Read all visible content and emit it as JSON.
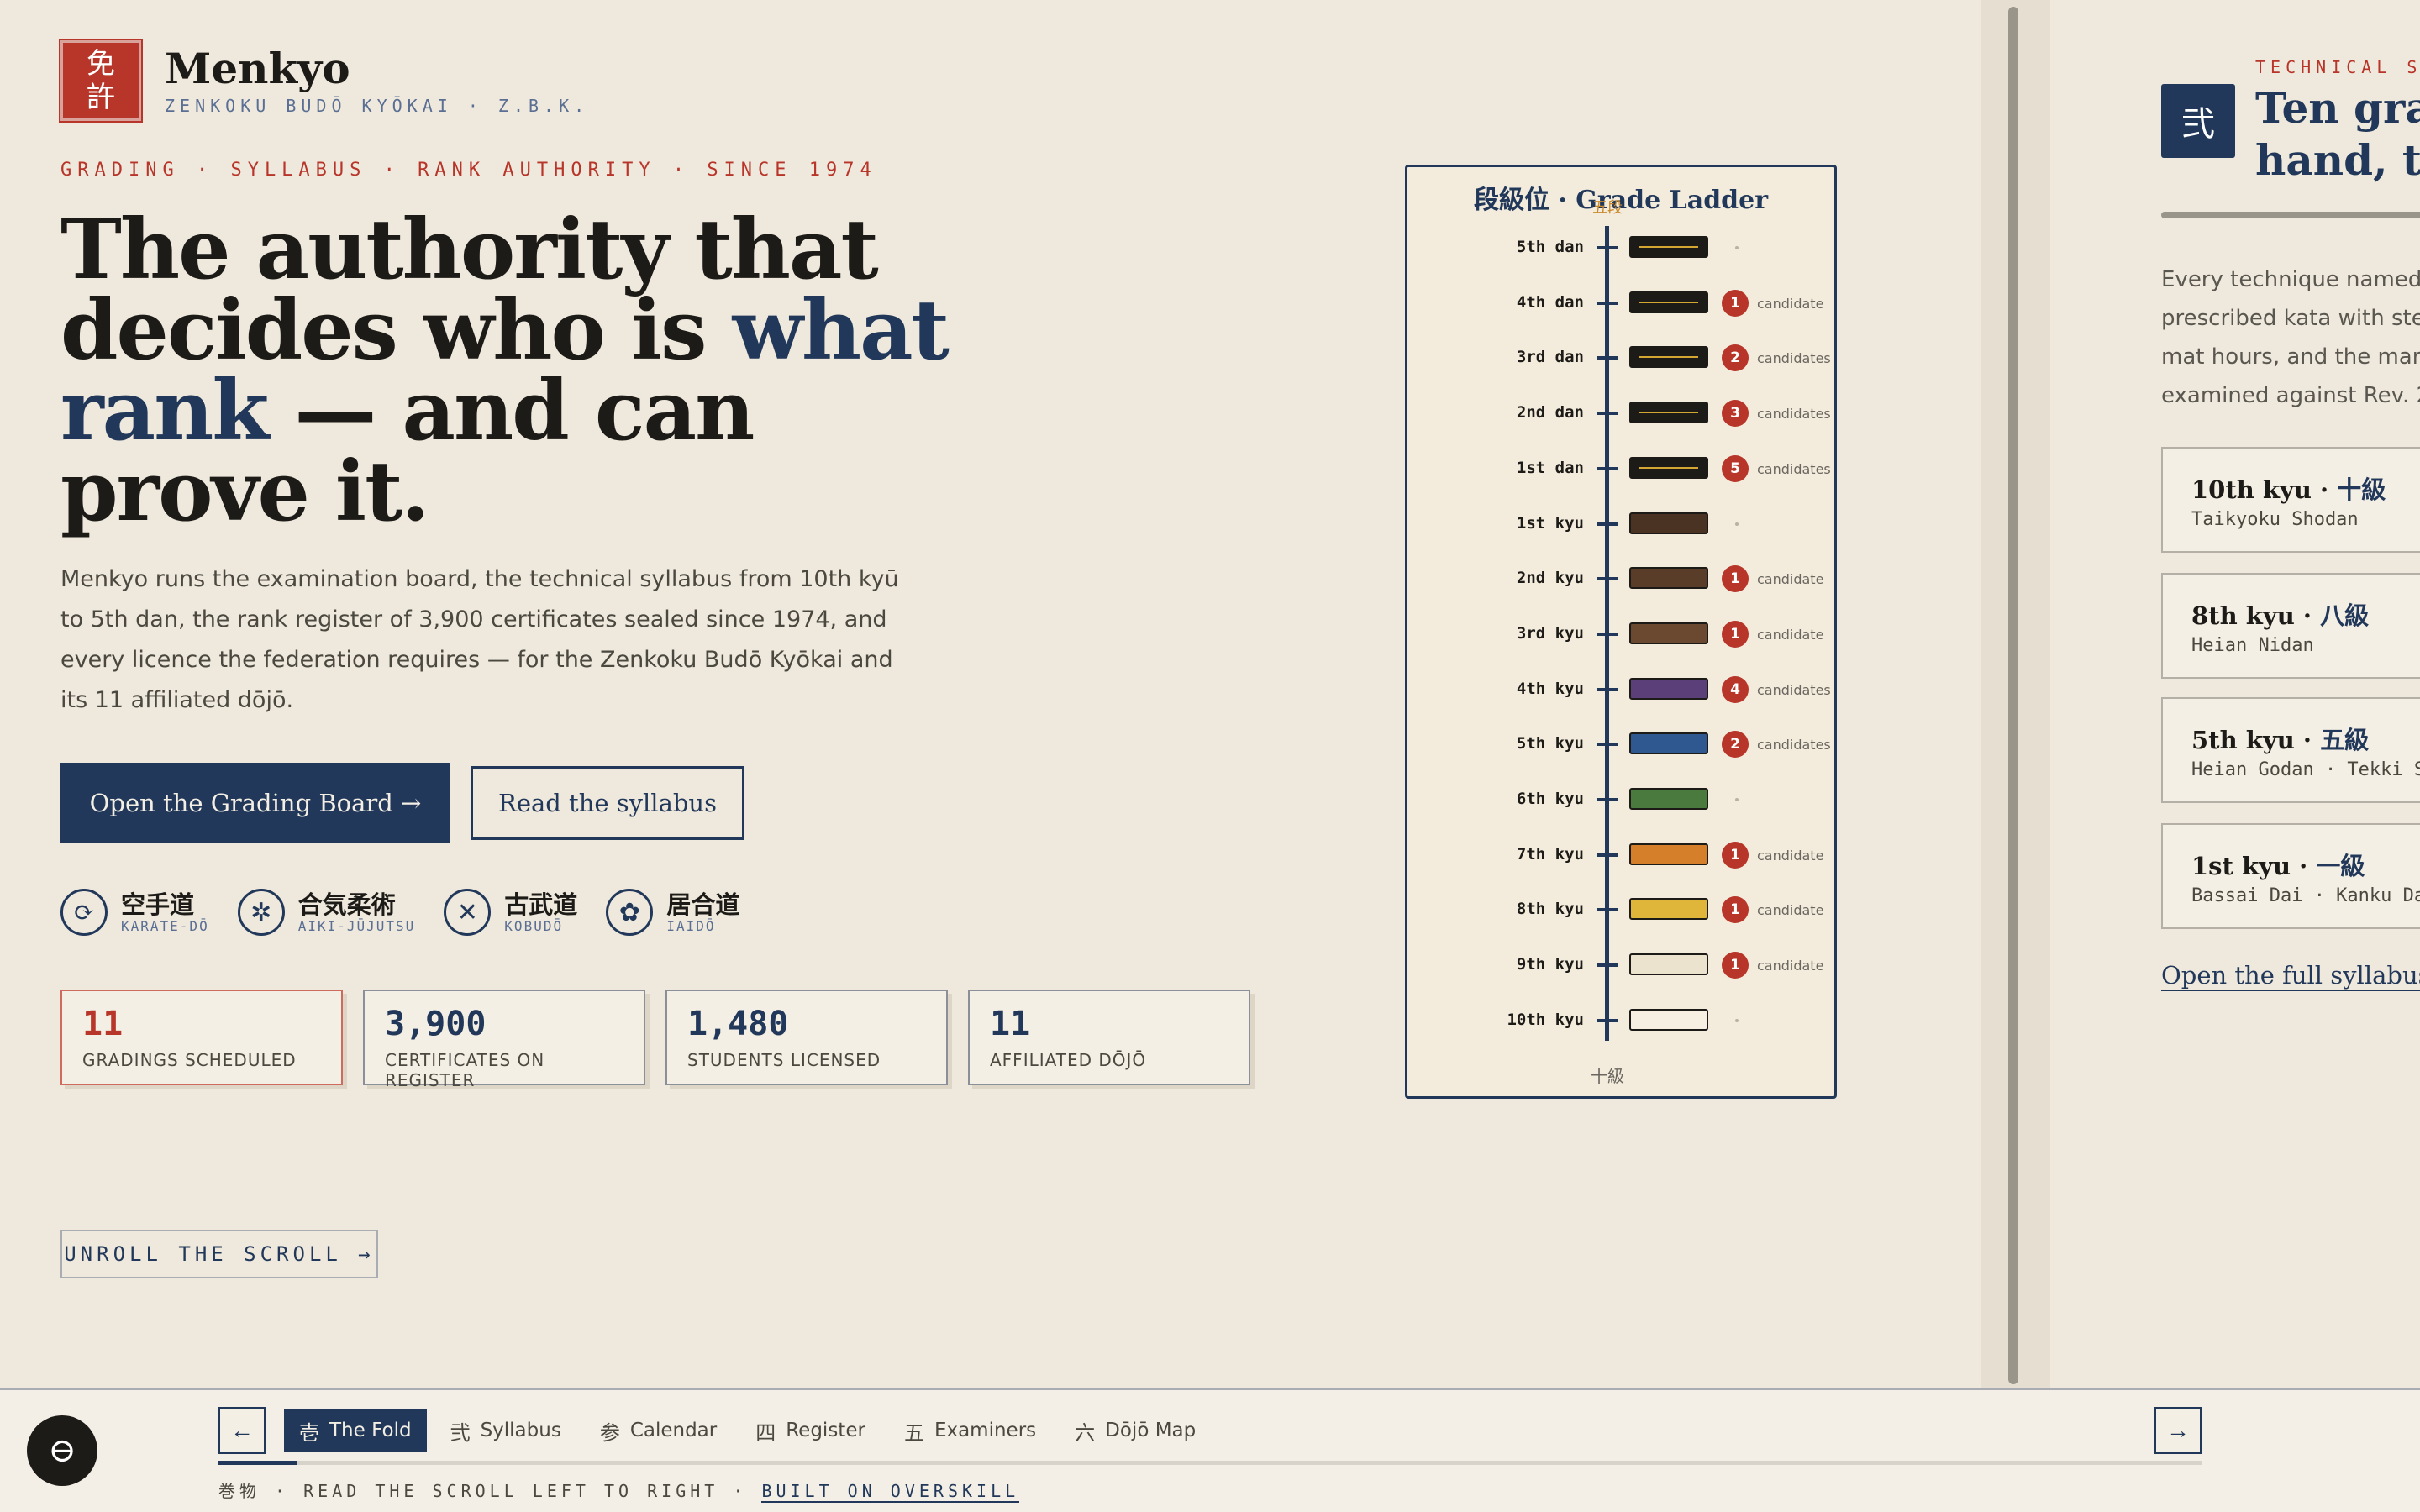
{
  "brand": {
    "seal_top": "免",
    "seal_bottom": "許",
    "name": "Menkyo",
    "subtitle": "ZENKOKU BUDŌ KYŌKAI · Z.B.K."
  },
  "hero": {
    "eyebrow": "GRADING · SYLLABUS · RANK AUTHORITY · SINCE 1974",
    "headline_pre": "The authority that decides who is ",
    "headline_accent": "what rank",
    "headline_post": " — and can prove it.",
    "lede": "Menkyo runs the examination board, the technical syllabus from 10th kyū to 5th dan, the rank register of 3,900 certificates sealed since 1974, and every licence the federation requires — for the Zenkoku Budō Kyōkai and its 11 affiliated dōjō.",
    "primary_button": "Open the Grading Board →",
    "secondary_button": "Read the syllabus"
  },
  "arts": [
    {
      "jp": "空手道",
      "en": "KARATE-DŌ",
      "icon": "tomoe-icon",
      "glyph": "⟳"
    },
    {
      "jp": "合気柔術",
      "en": "AIKI-JŪJUTSU",
      "icon": "star-crest-icon",
      "glyph": "✲"
    },
    {
      "jp": "古武道",
      "en": "KOBUDŌ",
      "icon": "crossed-weapons-icon",
      "glyph": "✕"
    },
    {
      "jp": "居合道",
      "en": "IAIDŌ",
      "icon": "blossom-crest-icon",
      "glyph": "✿"
    }
  ],
  "stats": [
    {
      "value": "11",
      "label": "GRADINGS SCHEDULED"
    },
    {
      "value": "3,900",
      "label": "CERTIFICATES ON REGISTER"
    },
    {
      "value": "1,480",
      "label": "STUDENTS LICENSED"
    },
    {
      "value": "11",
      "label": "AFFILIATED DŌJŌ"
    }
  ],
  "unroll_label": "UNROLL THE SCROLL →",
  "ladder": {
    "title": "段級位 · Grade Ladder",
    "top_mark": "五段",
    "bottom_mark": "十級",
    "rungs": [
      {
        "label": "5th dan",
        "belt": "#1d1b17",
        "stripe": true,
        "count": "",
        "note": ""
      },
      {
        "label": "4th dan",
        "belt": "#1d1b17",
        "stripe": true,
        "count": "1",
        "note": "candidate"
      },
      {
        "label": "3rd dan",
        "belt": "#1d1b17",
        "stripe": true,
        "count": "2",
        "note": "candidates"
      },
      {
        "label": "2nd dan",
        "belt": "#1d1b17",
        "stripe": true,
        "count": "3",
        "note": "candidates"
      },
      {
        "label": "1st dan",
        "belt": "#1d1b17",
        "stripe": true,
        "count": "5",
        "note": "candidates"
      },
      {
        "label": "1st kyu",
        "belt": "#4a3322",
        "stripe": false,
        "count": "",
        "note": ""
      },
      {
        "label": "2nd kyu",
        "belt": "#5a3d28",
        "stripe": false,
        "count": "1",
        "note": "candidate"
      },
      {
        "label": "3rd kyu",
        "belt": "#6b4830",
        "stripe": false,
        "count": "1",
        "note": "candidate"
      },
      {
        "label": "4th kyu",
        "belt": "#5b3f78",
        "stripe": false,
        "count": "4",
        "note": "candidates"
      },
      {
        "label": "5th kyu",
        "belt": "#2f5891",
        "stripe": false,
        "count": "2",
        "note": "candidates"
      },
      {
        "label": "6th kyu",
        "belt": "#4b7a3e",
        "stripe": false,
        "count": "",
        "note": ""
      },
      {
        "label": "7th kyu",
        "belt": "#d57f2a",
        "stripe": false,
        "count": "1",
        "note": "candidate"
      },
      {
        "label": "8th kyu",
        "belt": "#dfb53a",
        "stripe": false,
        "count": "1",
        "note": "candidate"
      },
      {
        "label": "9th kyu",
        "belt": "#ece3cf",
        "stripe": false,
        "count": "1",
        "note": "candidate"
      },
      {
        "label": "10th kyu",
        "belt": "#f6f0e2",
        "stripe": false,
        "count": "",
        "note": ""
      }
    ]
  },
  "syllabus_panel": {
    "eyebrow": "TECHNICAL SY",
    "seal": "弐",
    "heading_line1": "Ten grad",
    "heading_line2": "hand, tw",
    "body": [
      "Every technique named in",
      "prescribed kata with step",
      "mat hours, and the marki",
      "examined against Rev. 20"
    ],
    "cards": [
      {
        "title": "10th kyu · ",
        "jp": "十級",
        "sub": "Taikyoku Shodan"
      },
      {
        "title": "8th kyu · ",
        "jp": "八級",
        "sub": "Heian Nidan"
      },
      {
        "title": "5th kyu · ",
        "jp": "五級",
        "sub": "Heian Godan · Tekki S"
      },
      {
        "title": "1st kyu · ",
        "jp": "一級",
        "sub": "Bassai Dai · Kanku Da"
      }
    ],
    "link": "Open the full syllabus"
  },
  "bottom_nav": {
    "prev": "←",
    "next": "→",
    "tabs": [
      {
        "num": "壱",
        "label": "The Fold",
        "active": true
      },
      {
        "num": "弐",
        "label": "Syllabus",
        "active": false
      },
      {
        "num": "参",
        "label": "Calendar",
        "active": false
      },
      {
        "num": "四",
        "label": "Register",
        "active": false
      },
      {
        "num": "五",
        "label": "Examiners",
        "active": false
      },
      {
        "num": "六",
        "label": "Dōjō Map",
        "active": false
      }
    ],
    "progress": 0.04,
    "footer_prefix": "巻物 · READ THE SCROLL LEFT TO RIGHT · ",
    "footer_link": "BUILT ON OVERSKILL"
  }
}
